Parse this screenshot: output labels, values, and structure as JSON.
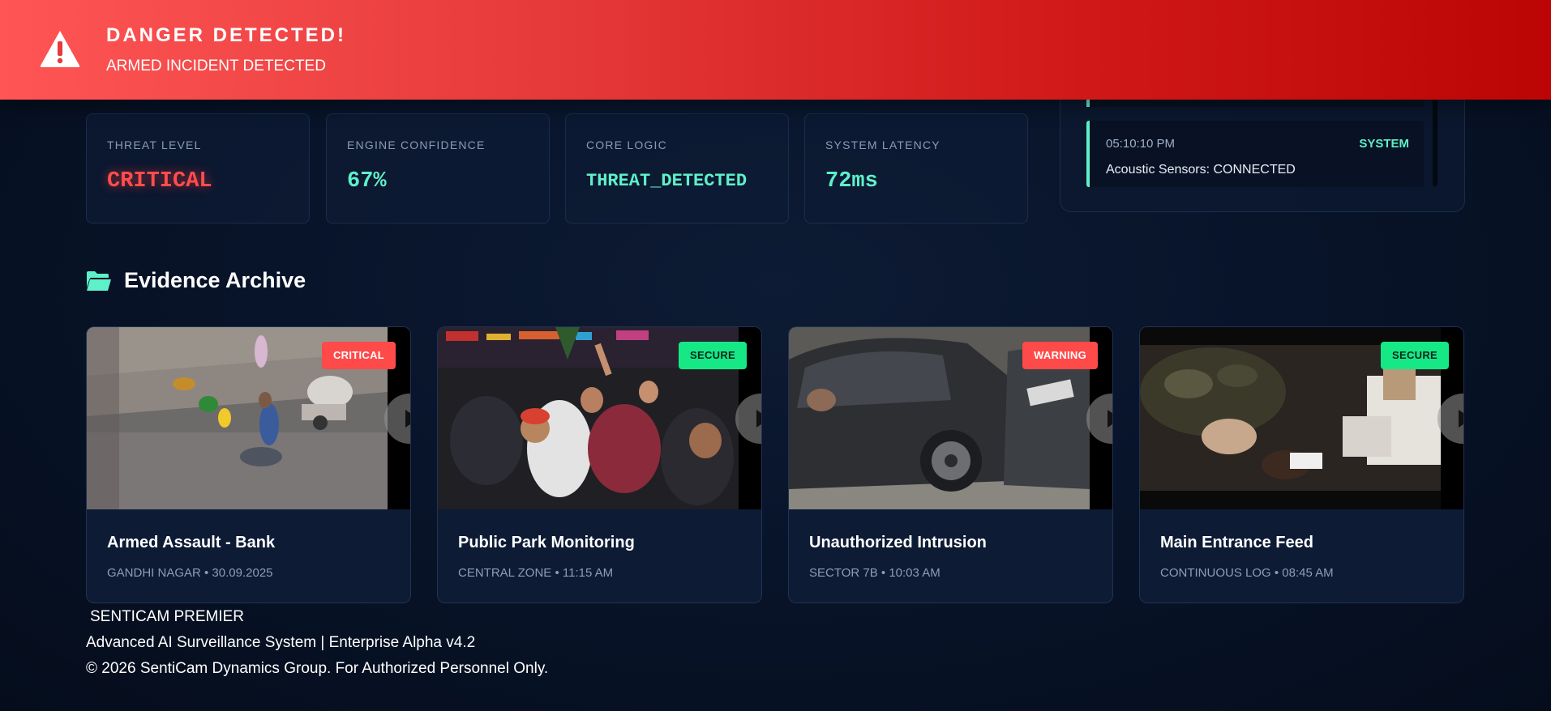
{
  "alert": {
    "title": "DANGER DETECTED!",
    "message": "ARMED INCIDENT DETECTED",
    "icon": "warning-triangle-icon",
    "colors": {
      "from": "#ff5555",
      "to": "#bb0505"
    }
  },
  "stats": [
    {
      "label": "THREAT LEVEL",
      "value": "CRITICAL",
      "color": "#ff4d4d"
    },
    {
      "label": "ENGINE CONFIDENCE",
      "value": "67%",
      "color": "#5ef0c9"
    },
    {
      "label": "CORE LOGIC",
      "value": "THREAT_DETECTED",
      "color": "#5ef0c9"
    },
    {
      "label": "SYSTEM LATENCY",
      "value": "72ms",
      "color": "#5ef0c9"
    }
  ],
  "log": {
    "entries": [
      {
        "time": "05:10:10 PM",
        "tag": "SYSTEM",
        "message": "Acoustic Sensors: CONNECTED"
      }
    ]
  },
  "archive": {
    "title": "Evidence Archive",
    "icon": "folder-open-icon",
    "cards": [
      {
        "badge": "CRITICAL",
        "status": "critical",
        "title": "Armed Assault - Bank",
        "meta": "GANDHI NAGAR • 30.09.2025"
      },
      {
        "badge": "SECURE",
        "status": "secure",
        "title": "Public Park Monitoring",
        "meta": "CENTRAL ZONE • 11:15 AM"
      },
      {
        "badge": "WARNING",
        "status": "warning",
        "title": "Unauthorized Intrusion",
        "meta": "SECTOR 7B • 10:03 AM"
      },
      {
        "badge": "SECURE",
        "status": "secure",
        "title": "Main Entrance Feed",
        "meta": "CONTINUOUS LOG • 08:45 AM"
      }
    ]
  },
  "footer": {
    "brand": "SENTICAM PREMIER",
    "tagline": "Advanced AI Surveillance System | Enterprise Alpha v4.2",
    "copyright": "© 2026 SentiCam Dynamics Group. For Authorized Personnel Only."
  },
  "colors": {
    "accent": "#5ef0c9",
    "critical": "#ff4a4a",
    "secure": "#16e886",
    "background": "#08142a"
  }
}
